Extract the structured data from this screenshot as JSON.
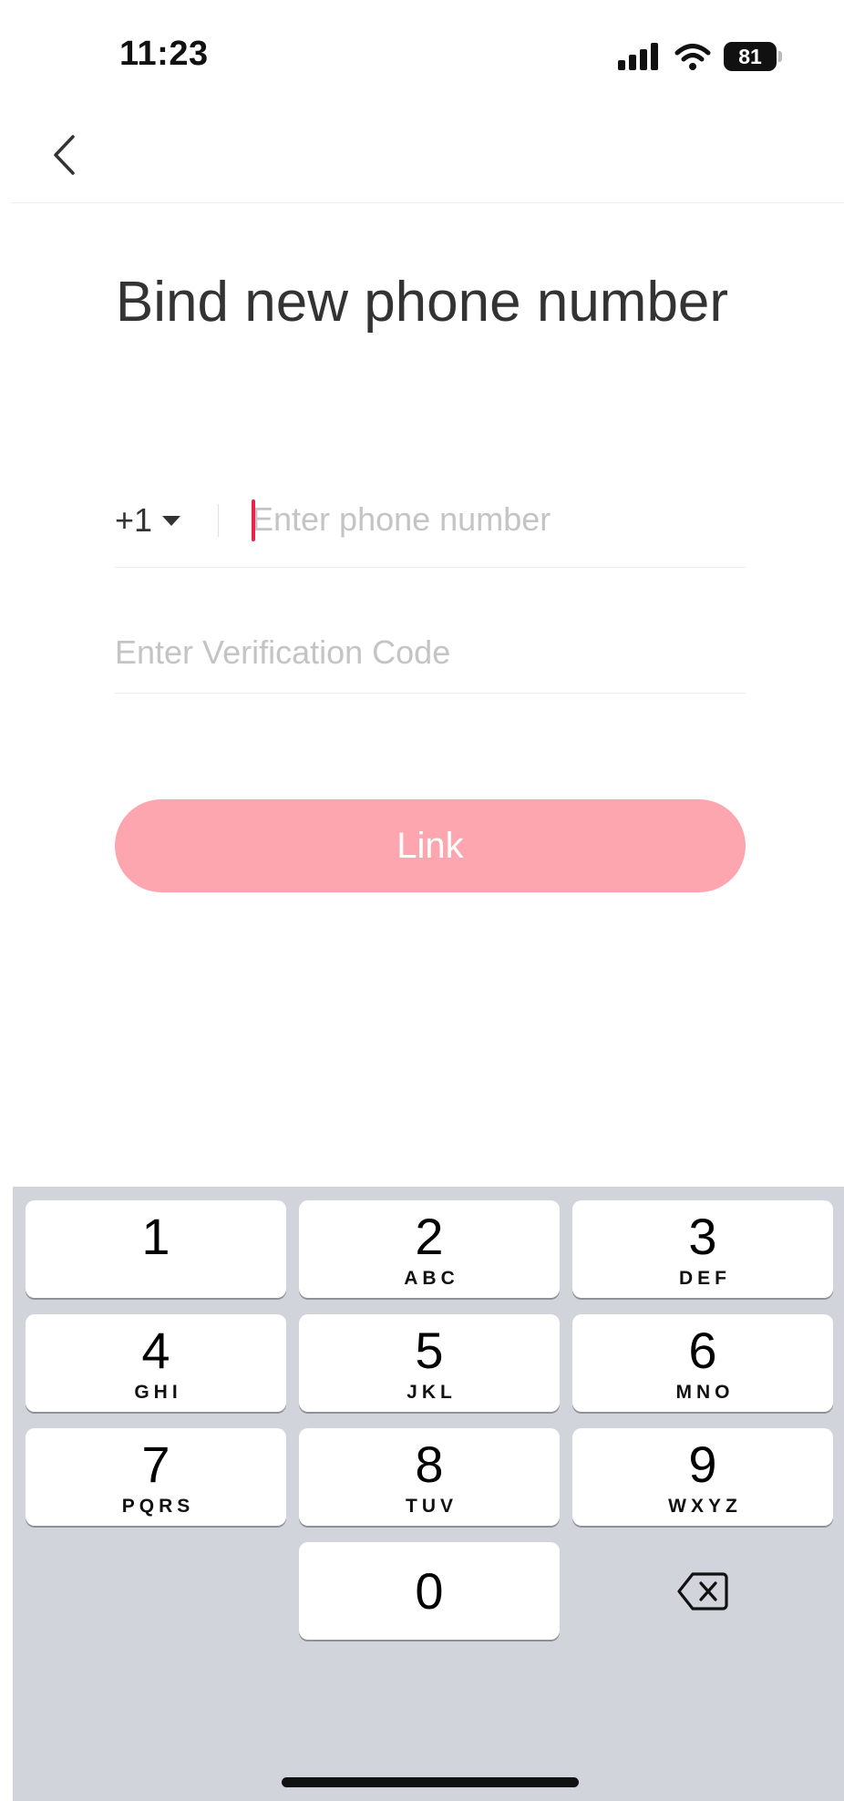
{
  "status_bar": {
    "time": "11:23",
    "battery": "81"
  },
  "page": {
    "title": "Bind new phone number"
  },
  "phone": {
    "country_code": "+1",
    "placeholder": "Enter phone number",
    "value": ""
  },
  "verification": {
    "placeholder": "Enter Verification Code",
    "value": ""
  },
  "actions": {
    "link_label": "Link"
  },
  "colors": {
    "accent": "#e8244c",
    "button_disabled": "#fda6b0",
    "keyboard_bg": "#d1d4da"
  },
  "keypad": {
    "keys": [
      {
        "digit": "1",
        "letters": ""
      },
      {
        "digit": "2",
        "letters": "ABC"
      },
      {
        "digit": "3",
        "letters": "DEF"
      },
      {
        "digit": "4",
        "letters": "GHI"
      },
      {
        "digit": "5",
        "letters": "JKL"
      },
      {
        "digit": "6",
        "letters": "MNO"
      },
      {
        "digit": "7",
        "letters": "PQRS"
      },
      {
        "digit": "8",
        "letters": "TUV"
      },
      {
        "digit": "9",
        "letters": "WXYZ"
      },
      {
        "digit": "0",
        "letters": ""
      }
    ],
    "delete_icon": "backspace-icon"
  }
}
